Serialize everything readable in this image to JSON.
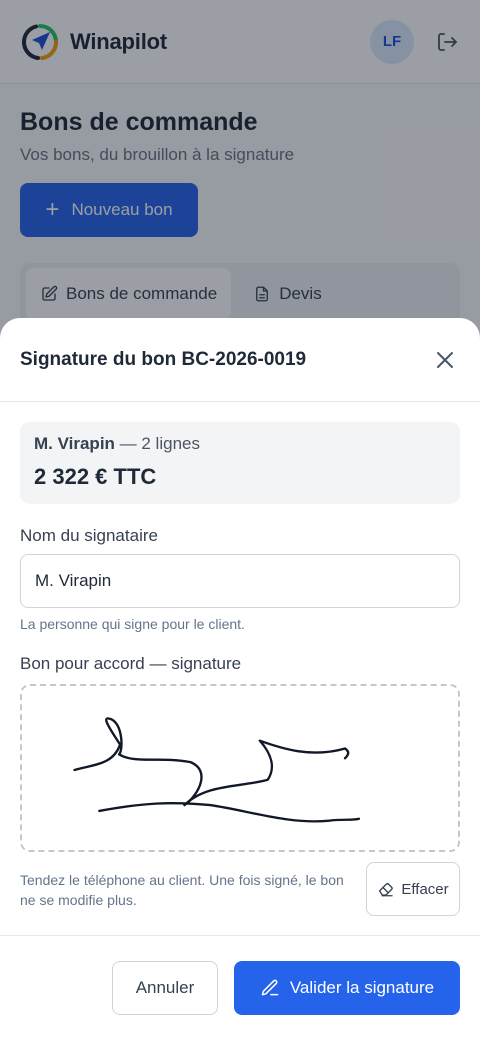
{
  "app": {
    "brand": "Winapilot",
    "avatar_initials": "LF",
    "page_title": "Bons de commande",
    "page_subtitle": "Vos bons, du brouillon à la signature",
    "new_button_label": "Nouveau bon",
    "tabs": [
      {
        "label": "Bons de commande",
        "active": true,
        "icon": "edit-document-icon"
      },
      {
        "label": "Devis",
        "active": false,
        "icon": "document-icon"
      }
    ]
  },
  "sheet": {
    "title": "Signature du bon BC-2026-0019",
    "summary": {
      "client": "M. Virapin",
      "lines_text": " — 2 lignes",
      "total": "2 322 € TTC"
    },
    "signer_label": "Nom du signataire",
    "signer_value": "M. Virapin",
    "signer_hint": "La personne qui signe pour le client.",
    "signature_label": "Bon pour accord — signature",
    "signature_note": "Tendez le téléphone au client. Une fois signé, le bon ne se modifie plus.",
    "erase_label": "Effacer",
    "cancel_label": "Annuler",
    "validate_label": "Valider la signature"
  },
  "colors": {
    "primary": "#2563eb",
    "overlay": "rgba(17,24,39,0.42)"
  }
}
